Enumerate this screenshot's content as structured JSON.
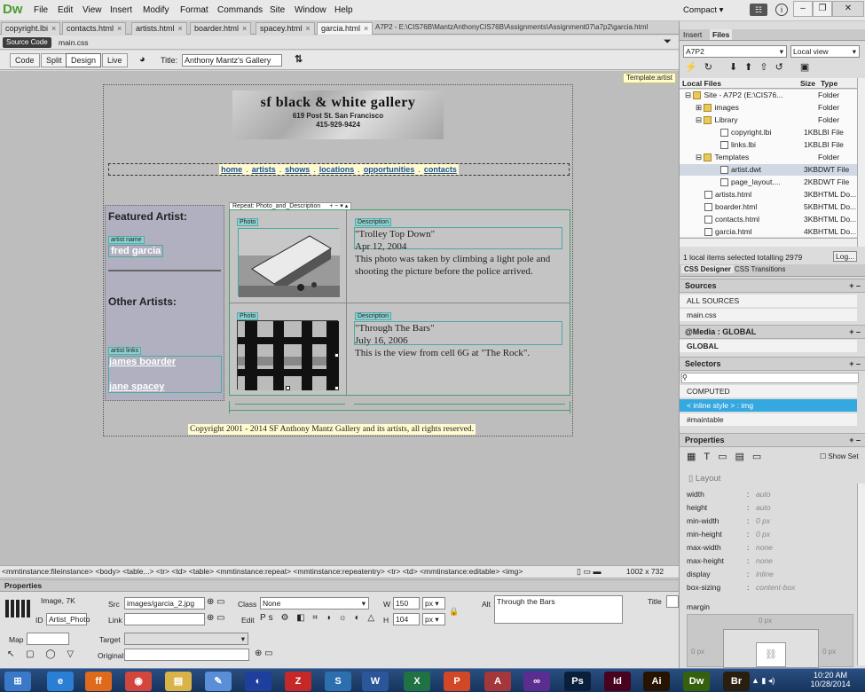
{
  "app": {
    "logo": "Dw",
    "menu": [
      "File",
      "Edit",
      "View",
      "Insert",
      "Modify",
      "Format",
      "Commands",
      "Site",
      "Window",
      "Help"
    ],
    "workspace": "Compact"
  },
  "doc_tabs": [
    {
      "label": "copyright.lbi"
    },
    {
      "label": "contacts.html"
    },
    {
      "label": "artists.html"
    },
    {
      "label": "boarder.html"
    },
    {
      "label": "spacey.html"
    },
    {
      "label": "garcia.html",
      "active": true
    }
  ],
  "doc_path": "A7P2 - E:\\CIS76B\\MantzAnthonyCIS76B\\Assignments\\Assignment07\\a7p2\\garcia.html",
  "related_files": {
    "source": "Source Code",
    "css": "main.css"
  },
  "doc_toolbar": {
    "views": [
      "Code",
      "Split",
      "Design",
      "Live"
    ],
    "title_label": "Title:",
    "title_value": "Anthony Mantz's Gallery"
  },
  "page": {
    "template_badge": "Template:artist",
    "header": {
      "title": "sf black & white gallery",
      "address": "619 Post St. San Francisco",
      "phone": "415-929-9424"
    },
    "nav": [
      "home",
      "artists",
      "shows",
      "locations",
      "opportunities",
      "contacts"
    ],
    "nav_sep": ".",
    "sidebar": {
      "featured_heading": "Featured Artist:",
      "artist_name_label": "artist name",
      "artist_name": "fred garcia",
      "other_heading": "Other Artists:",
      "links_label": "artist links",
      "links": [
        "james boarder",
        "jane spacey"
      ]
    },
    "repeat_label": "Repeat: Photo_and_Description",
    "repeat_controls": "+ − ▾ ▴",
    "photo_label": "Photo",
    "desc_label": "Description",
    "items": [
      {
        "title": "\"Trolley Top Down\"",
        "date": "Apr 12, 2004",
        "desc": "This photo was taken by climbing a light pole and shooting the picture before the police arrived."
      },
      {
        "title": "\"Through The Bars\"",
        "date": "July 16, 2006",
        "desc": "This is the view from cell 6G at \"The Rock\"."
      }
    ],
    "footer": "Copyright 2001 - 2014 SF Anthony Mantz Gallery and its artists, all rights reserved."
  },
  "tag_selector": "<mmtinstance:fileinstance> <body> <table...> <tr> <td> <table> <mmtinstance:repeat> <mmtinstance:repeatentry> <tr> <td> <mmtinstance:editable> <img>",
  "window_size": "1002 x 732",
  "properties": {
    "title": "Properties",
    "type": "Image, 7K",
    "id_label": "ID",
    "id_value": "Artist_Photo",
    "src_label": "Src",
    "src": "images/garcia_2.jpg",
    "link_label": "Link",
    "link": "",
    "class_label": "Class",
    "class": "None",
    "edit_label": "Edit",
    "w_label": "W",
    "w": "150",
    "h_label": "H",
    "h": "104",
    "unit": "px",
    "alt_label": "Alt",
    "alt": "Through the Bars",
    "title_label": "Title",
    "map_label": "Map",
    "map": "",
    "target_label": "Target",
    "original_label": "Original"
  },
  "files_panel": {
    "tabs": [
      "Insert",
      "Files"
    ],
    "site": "A7P2",
    "view": "Local view",
    "col_local": "Local Files",
    "col_size": "Size",
    "col_type": "Type",
    "rows": [
      {
        "name": "Site - A7P2 (E:\\CIS76...",
        "size": "",
        "type": "Folder",
        "indent": 0,
        "kind": "folder"
      },
      {
        "name": "images",
        "size": "",
        "type": "Folder",
        "indent": 1,
        "kind": "folder"
      },
      {
        "name": "Library",
        "size": "",
        "type": "Folder",
        "indent": 1,
        "kind": "folder"
      },
      {
        "name": "copyright.lbi",
        "size": "1KB",
        "type": "LBI File",
        "indent": 2,
        "kind": "doc"
      },
      {
        "name": "links.lbi",
        "size": "1KB",
        "type": "LBI File",
        "indent": 2,
        "kind": "doc"
      },
      {
        "name": "Templates",
        "size": "",
        "type": "Folder",
        "indent": 1,
        "kind": "folder"
      },
      {
        "name": "artist.dwt",
        "size": "3KB",
        "type": "DWT File",
        "indent": 2,
        "kind": "doc",
        "selected": true
      },
      {
        "name": "page_layout....",
        "size": "2KB",
        "type": "DWT File",
        "indent": 2,
        "kind": "doc"
      },
      {
        "name": "artists.html",
        "size": "3KB",
        "type": "HTML Do...",
        "indent": 1,
        "kind": "doc"
      },
      {
        "name": "boarder.html",
        "size": "5KB",
        "type": "HTML Do...",
        "indent": 1,
        "kind": "doc"
      },
      {
        "name": "contacts.html",
        "size": "3KB",
        "type": "HTML Do...",
        "indent": 1,
        "kind": "doc"
      },
      {
        "name": "garcia.html",
        "size": "4KB",
        "type": "HTML Do...",
        "indent": 1,
        "kind": "doc"
      }
    ],
    "status": "1 local items selected totalling 2979",
    "log": "Log..."
  },
  "css_panel": {
    "tabs": [
      "CSS Designer",
      "CSS Transitions"
    ],
    "sources_label": "Sources",
    "sources": [
      "ALL SOURCES",
      "main.css"
    ],
    "media_label": "@Media : GLOBAL",
    "media": "GLOBAL",
    "selectors_label": "Selectors",
    "selectors": [
      "COMPUTED",
      "< inline style > : img",
      "#maintable"
    ],
    "properties_label": "Properties",
    "show_set": "Show Set",
    "layout_label": "Layout",
    "props": [
      {
        "k": "width",
        "v": "auto"
      },
      {
        "k": "height",
        "v": "auto"
      },
      {
        "k": "min-width",
        "v": "0 px"
      },
      {
        "k": "min-height",
        "v": "0 px"
      },
      {
        "k": "max-width",
        "v": "none"
      },
      {
        "k": "max-height",
        "v": "none"
      },
      {
        "k": "display",
        "v": "inline"
      },
      {
        "k": "box-sizing",
        "v": "content-box"
      }
    ],
    "margin_label": "margin",
    "margin_vals": [
      "0 px",
      "0 px",
      "0 px"
    ]
  },
  "taskbar": {
    "time": "10:20 AM",
    "date": "10/28/2014",
    "icons": [
      {
        "n": "windows-start",
        "t": "⊞",
        "c": "#3a78c8"
      },
      {
        "n": "ie",
        "t": "e",
        "c": "#2a7fd4"
      },
      {
        "n": "firefox",
        "t": "ff",
        "c": "#e06a1c"
      },
      {
        "n": "chrome",
        "t": "◉",
        "c": "#d3463b"
      },
      {
        "n": "explorer",
        "t": "▤",
        "c": "#d9b34a"
      },
      {
        "n": "paint",
        "t": "✎",
        "c": "#5a8fd8"
      },
      {
        "n": "app-blue",
        "t": "◐",
        "c": "#1e3f9e"
      },
      {
        "n": "filezilla",
        "t": "Z",
        "c": "#c62828"
      },
      {
        "n": "app-teal",
        "t": "S",
        "c": "#2b6fae"
      },
      {
        "n": "word",
        "t": "W",
        "c": "#2b579a"
      },
      {
        "n": "excel",
        "t": "X",
        "c": "#207245"
      },
      {
        "n": "powerpoint",
        "t": "P",
        "c": "#d24726"
      },
      {
        "n": "access",
        "t": "A",
        "c": "#a4373a"
      },
      {
        "n": "infinity",
        "t": "∞",
        "c": "#5a2d91"
      },
      {
        "n": "photoshop",
        "t": "Ps",
        "c": "#0a1f3c"
      },
      {
        "n": "indesign",
        "t": "Id",
        "c": "#49021f"
      },
      {
        "n": "illustrator",
        "t": "Ai",
        "c": "#261300"
      },
      {
        "n": "dreamweaver",
        "t": "Dw",
        "c": "#35600e"
      },
      {
        "n": "bridge",
        "t": "Br",
        "c": "#2a1f0f"
      }
    ]
  }
}
